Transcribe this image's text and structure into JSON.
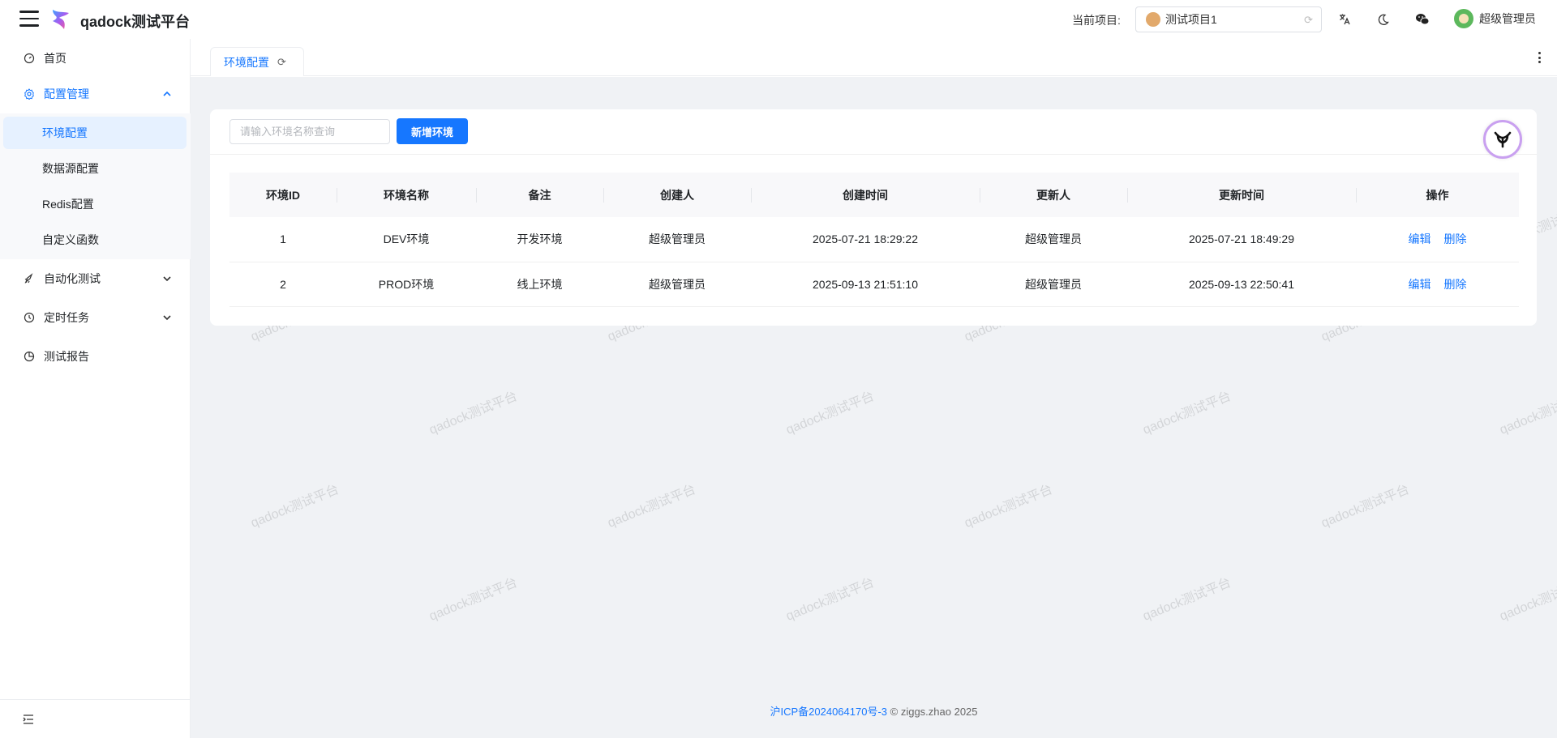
{
  "header": {
    "app_title": "qadock测试平台",
    "project_label": "当前项目:",
    "project_value": "测试项目1",
    "user_name": "超级管理员"
  },
  "sidebar": {
    "home": "首页",
    "config": "配置管理",
    "config_items": [
      "环境配置",
      "数据源配置",
      "Redis配置",
      "自定义函数"
    ],
    "automation": "自动化测试",
    "scheduled": "定时任务",
    "report": "测试报告"
  },
  "tabs": [
    {
      "label": "环境配置"
    }
  ],
  "toolbar": {
    "search_placeholder": "请输入环境名称查询",
    "add_label": "新增环境"
  },
  "table": {
    "columns": [
      "环境ID",
      "环境名称",
      "备注",
      "创建人",
      "创建时间",
      "更新人",
      "更新时间",
      "操作"
    ],
    "rows": [
      {
        "id": "1",
        "name": "DEV环境",
        "remark": "开发环境",
        "creator": "超级管理员",
        "created": "2025-07-21 18:29:22",
        "updater": "超级管理员",
        "updated": "2025-07-21 18:49:29",
        "edit": "编辑",
        "delete": "删除"
      },
      {
        "id": "2",
        "name": "PROD环境",
        "remark": "线上环境",
        "creator": "超级管理员",
        "created": "2025-09-13 21:51:10",
        "updater": "超级管理员",
        "updated": "2025-09-13 22:50:41",
        "edit": "编辑",
        "delete": "删除"
      }
    ]
  },
  "watermark": "qadock测试平台",
  "footer": {
    "icp": "沪ICP备2024064170号-3",
    "copyright": "© ziggs.zhao 2025"
  },
  "colors": {
    "accent": "#1677ff",
    "background": "#f0f2f5"
  }
}
